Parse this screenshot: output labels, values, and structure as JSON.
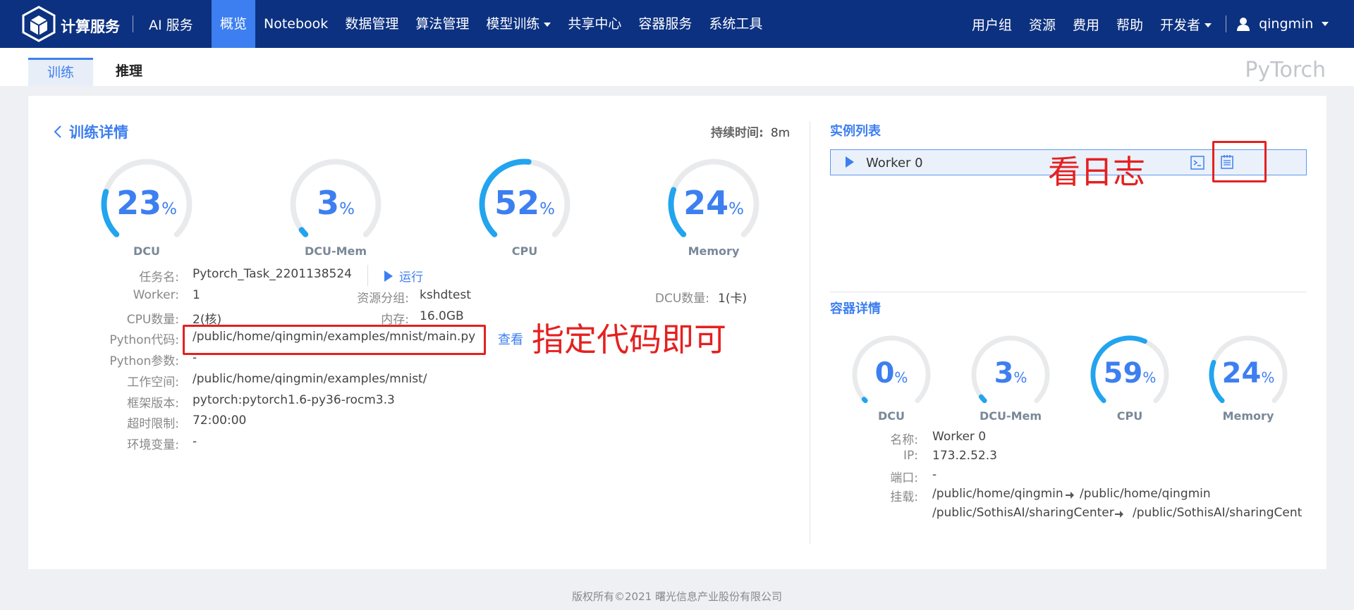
{
  "header": {
    "brand": "计算服务",
    "ai_label": "AI 服务",
    "nav": [
      "概览",
      "Notebook",
      "数据管理",
      "算法管理",
      "模型训练",
      "共享中心",
      "容器服务",
      "系统工具"
    ],
    "active_nav": "概览",
    "right_nav": [
      "用户组",
      "资源",
      "费用",
      "帮助",
      "开发者"
    ],
    "username": "qingmin",
    "colors": {
      "bar": "#0c3180",
      "active": "#3d7ff0"
    }
  },
  "tabs": [
    "训练",
    "推理"
  ],
  "active_tab": "训练",
  "framework_label": "PyTorch",
  "detail": {
    "title": "训练详情",
    "duration_label": "持续时间:",
    "duration_value": "8m",
    "gauges": [
      {
        "value": "23",
        "unit": "%",
        "label": "DCU",
        "percent": 23
      },
      {
        "value": "3",
        "unit": "%",
        "label": "DCU-Mem",
        "percent": 3
      },
      {
        "value": "52",
        "unit": "%",
        "label": "CPU",
        "percent": 52
      },
      {
        "value": "24",
        "unit": "%",
        "label": "Memory",
        "percent": 24
      }
    ],
    "fields": {
      "task_name": {
        "label": "任务名:",
        "value": "Pytorch_Task_2201138524"
      },
      "run_label": "运行",
      "worker": {
        "label": "Worker:",
        "value": "1"
      },
      "resource_group": {
        "label": "资源分组:",
        "value": "kshdtest"
      },
      "dcu_count": {
        "label": "DCU数量:",
        "value": "1(卡)"
      },
      "cpu_count": {
        "label": "CPU数量:",
        "value": "2(核)"
      },
      "memory": {
        "label": "内存:",
        "value": "16.0GB"
      },
      "python_code": {
        "label": "Python代码:",
        "value": "/public/home/qingmin/examples/mnist/main.py"
      },
      "view_label": "查看",
      "python_params": {
        "label": "Python参数:",
        "value": "-"
      },
      "workspace": {
        "label": "工作空间:",
        "value": "/public/home/qingmin/examples/mnist/"
      },
      "framework_version": {
        "label": "框架版本:",
        "value": "pytorch:pytorch1.6-py36-rocm3.3"
      },
      "timeout": {
        "label": "超时限制:",
        "value": "72:00:00"
      },
      "env_vars": {
        "label": "环境变量:",
        "value": "-"
      }
    }
  },
  "annotations": {
    "code": "指定代码即可",
    "log": "看日志"
  },
  "instances": {
    "title": "实例列表",
    "items": [
      {
        "name": "Worker 0"
      }
    ],
    "icons": [
      "terminal-icon",
      "log-icon"
    ]
  },
  "container": {
    "title": "容器详情",
    "gauges": [
      {
        "value": "0",
        "unit": "%",
        "label": "DCU",
        "percent": 0
      },
      {
        "value": "3",
        "unit": "%",
        "label": "DCU-Mem",
        "percent": 3
      },
      {
        "value": "59",
        "unit": "%",
        "label": "CPU",
        "percent": 59
      },
      {
        "value": "24",
        "unit": "%",
        "label": "Memory",
        "percent": 24
      }
    ],
    "name": {
      "label": "名称:",
      "value": "Worker 0"
    },
    "ip": {
      "label": "IP:",
      "value": "173.2.52.3"
    },
    "port": {
      "label": "端口:",
      "value": "-"
    },
    "mount_label": "挂载:",
    "mounts": [
      {
        "src": "/public/home/qingmin",
        "dst": "/public/home/qingmin"
      },
      {
        "src": "/public/SothisAI/sharingCenter",
        "dst": "/public/SothisAI/sharingCent"
      }
    ]
  },
  "footer": "版权所有©2021 曙光信息产业股份有限公司"
}
